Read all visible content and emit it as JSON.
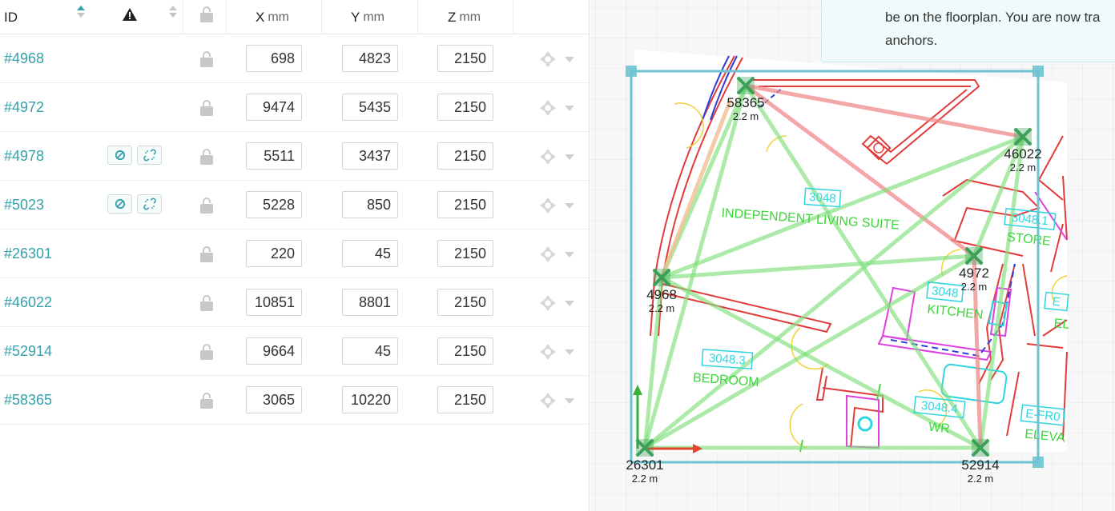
{
  "table": {
    "headers": {
      "id": "ID",
      "x": "X",
      "y": "Y",
      "z": "Z",
      "unit": "mm"
    },
    "rows": [
      {
        "id": "#4968",
        "x": "698",
        "y": "4823",
        "z": "2150",
        "flags": false
      },
      {
        "id": "#4972",
        "x": "9474",
        "y": "5435",
        "z": "2150",
        "flags": false
      },
      {
        "id": "#4978",
        "x": "5511",
        "y": "3437",
        "z": "2150",
        "flags": true
      },
      {
        "id": "#5023",
        "x": "5228",
        "y": "850",
        "z": "2150",
        "flags": true
      },
      {
        "id": "#26301",
        "x": "220",
        "y": "45",
        "z": "2150",
        "flags": false
      },
      {
        "id": "#46022",
        "x": "10851",
        "y": "8801",
        "z": "2150",
        "flags": false
      },
      {
        "id": "#52914",
        "x": "9664",
        "y": "45",
        "z": "2150",
        "flags": false
      },
      {
        "id": "#58365",
        "x": "3065",
        "y": "10220",
        "z": "2150",
        "flags": false
      }
    ]
  },
  "map": {
    "info_text_line1": "be on the floorplan. You are now tra",
    "info_text_line2": "anchors.",
    "anchors": [
      {
        "id": "58365",
        "height": "2.2 m"
      },
      {
        "id": "46022",
        "height": "2.2 m"
      },
      {
        "id": "4972",
        "height": "2.2 m"
      },
      {
        "id": "4968",
        "height": "2.2 m"
      },
      {
        "id": "26301",
        "height": "2.2 m"
      },
      {
        "id": "52914",
        "height": "2.2 m"
      }
    ],
    "rooms": [
      {
        "code": "3048",
        "name": "INDEPENDENT LIVING SUITE"
      },
      {
        "code": "3048.1",
        "name": "STORE"
      },
      {
        "code": "3048.3",
        "name": "BEDROOM"
      },
      {
        "code": "3048.4",
        "name": "WR"
      },
      {
        "code": "3048",
        "name": "KITCHEN"
      },
      {
        "code": "E-FR0",
        "name": "ELEVA"
      },
      {
        "code": "E",
        "name": "EL"
      }
    ]
  },
  "colors": {
    "link": "#33a0ab",
    "anchor": "#3aa057",
    "wall": "#e23b3b",
    "range_good": "#7fe07a",
    "range_bad": "#f08a8a",
    "selection": "#6ec3d2"
  }
}
